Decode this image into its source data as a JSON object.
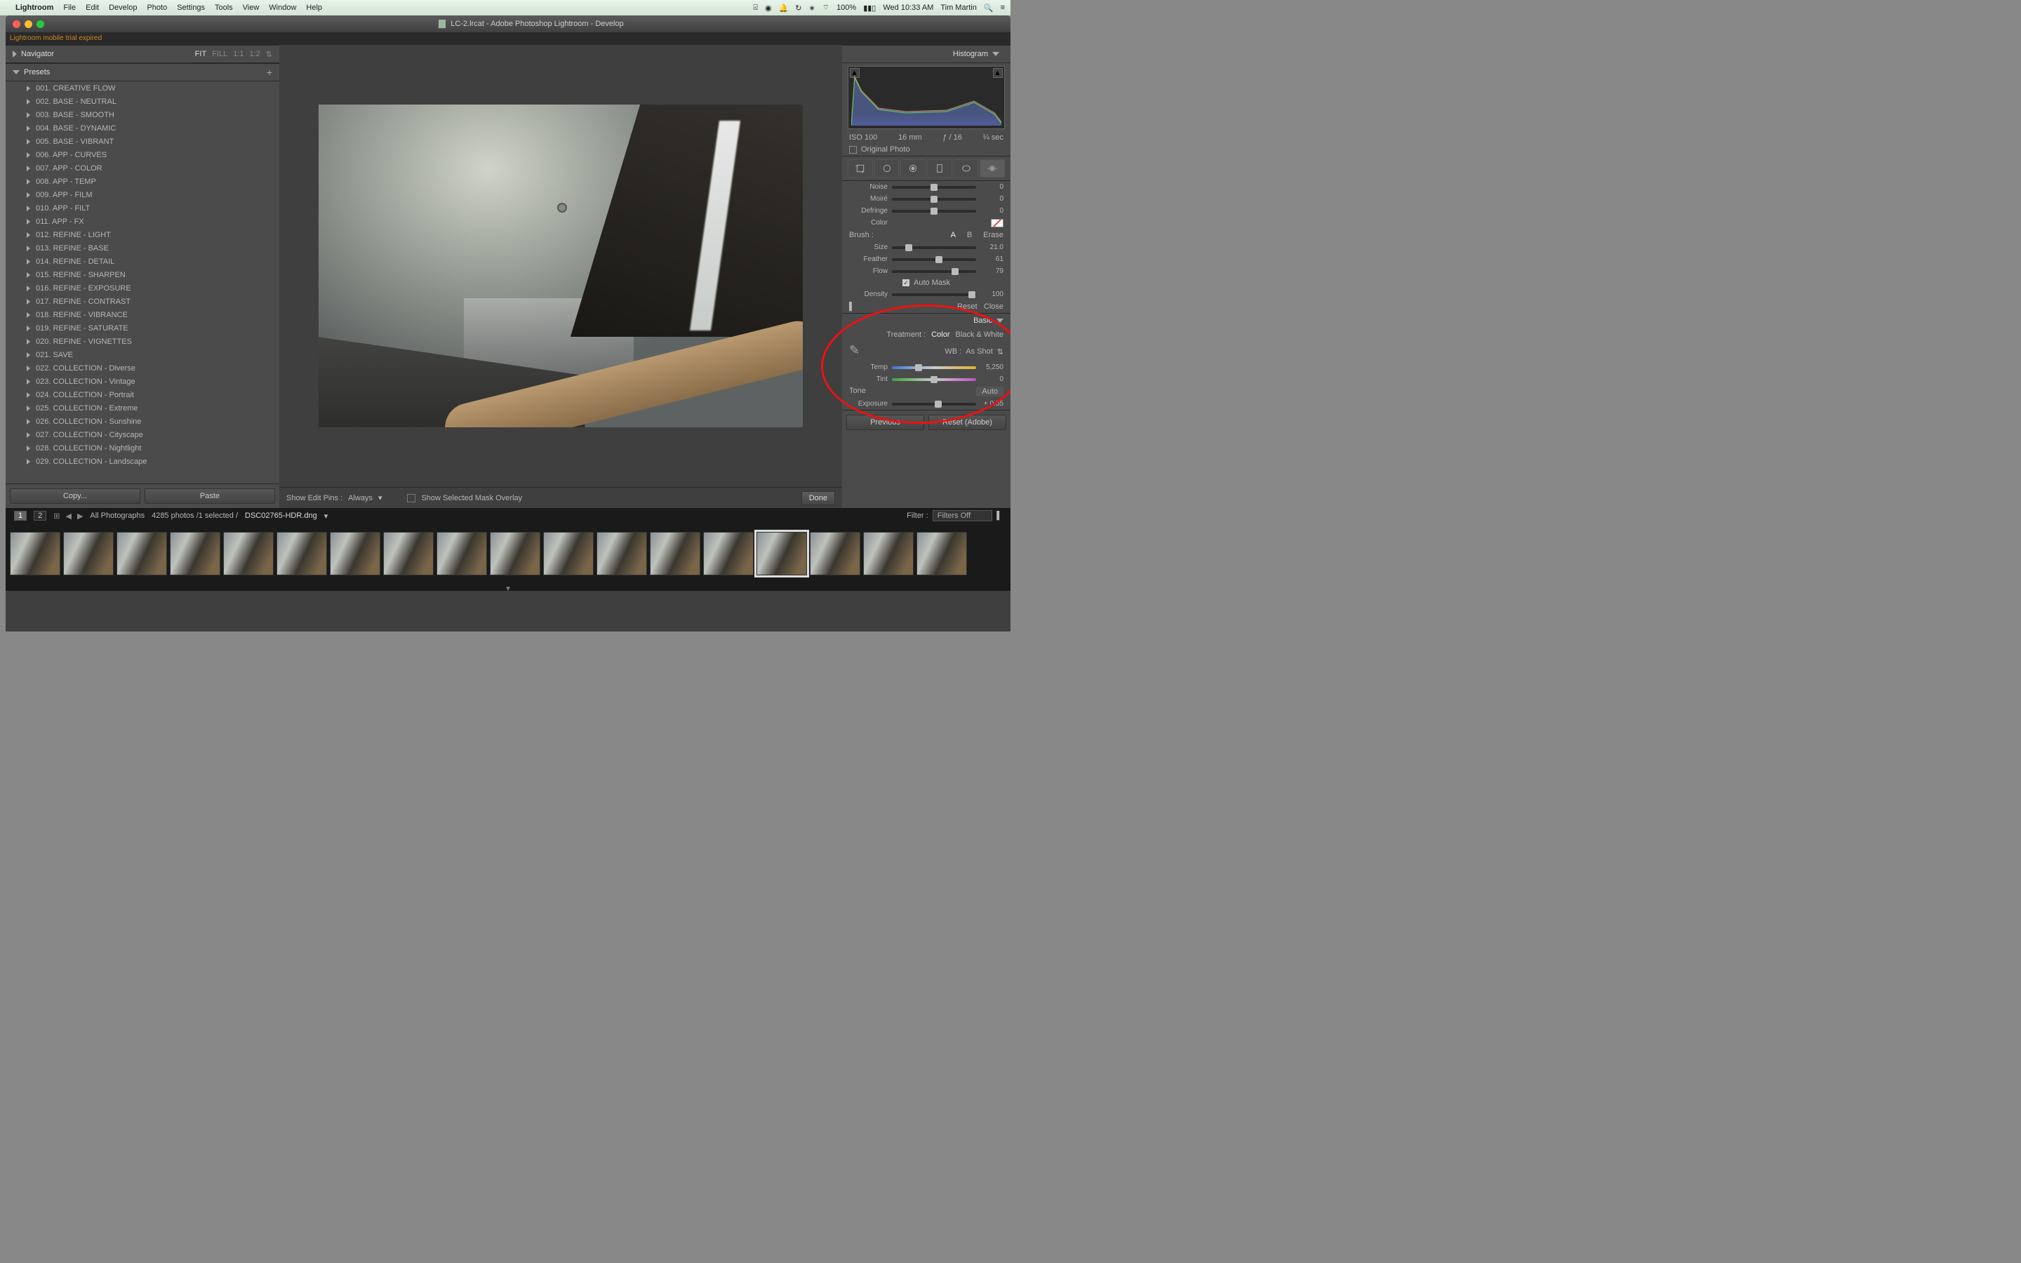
{
  "menubar": {
    "app": "Lightroom",
    "items": [
      "File",
      "Edit",
      "Develop",
      "Photo",
      "Settings",
      "Tools",
      "View",
      "Window",
      "Help"
    ],
    "battery": "100%",
    "time": "Wed 10:33 AM",
    "user": "Tim Martin"
  },
  "titlebar": {
    "title": "LC-2.lrcat - Adobe Photoshop Lightroom - Develop"
  },
  "warn": "Lightroom mobile trial expired",
  "nav": {
    "label": "Navigator",
    "opts": [
      "FIT",
      "FILL",
      "1:1",
      "1:2"
    ]
  },
  "presets": {
    "label": "Presets",
    "items": [
      "001. CREATIVE FLOW",
      "002. BASE - NEUTRAL",
      "003. BASE - SMOOTH",
      "004. BASE - DYNAMIC",
      "005. BASE - VIBRANT",
      "006. APP - CURVES",
      "007. APP - COLOR",
      "008. APP - TEMP",
      "009. APP - FILM",
      "010. APP - FILT",
      "011. APP - FX",
      "012. REFINE - LIGHT",
      "013. REFINE - BASE",
      "014. REFINE - DETAIL",
      "015. REFINE - SHARPEN",
      "016. REFINE - EXPOSURE",
      "017. REFINE - CONTRAST",
      "018. REFINE - VIBRANCE",
      "019. REFINE - SATURATE",
      "020. REFINE - VIGNETTES",
      "021. SAVE",
      "022. COLLECTION - Diverse",
      "023. COLLECTION - Vintage",
      "024. COLLECTION - Portrait",
      "025. COLLECTION - Extreme",
      "026. COLLECTION - Sunshine",
      "027. COLLECTION - Cityscape",
      "028. COLLECTION - Nightlight",
      "029. COLLECTION - Landscape"
    ]
  },
  "leftbtn": {
    "copy": "Copy...",
    "paste": "Paste"
  },
  "centerbar": {
    "pins": "Show Edit Pins :",
    "pinsval": "Always",
    "mask": "Show Selected Mask Overlay",
    "done": "Done"
  },
  "histo": {
    "label": "Histogram",
    "iso": "ISO 100",
    "focal": "16 mm",
    "ap": "ƒ / 16",
    "sh": "¼ sec",
    "orig": "Original Photo"
  },
  "adj": {
    "noise": {
      "label": "Noise",
      "val": "0",
      "pos": 50
    },
    "moire": {
      "label": "Moiré",
      "val": "0",
      "pos": 50
    },
    "defringe": {
      "label": "Defringe",
      "val": "0",
      "pos": 50
    },
    "color": "Color"
  },
  "brush": {
    "label": "Brush :",
    "a": "A",
    "b": "B",
    "erase": "Erase",
    "size": {
      "label": "Size",
      "val": "21.0",
      "pos": 20
    },
    "feather": {
      "label": "Feather",
      "val": "61",
      "pos": 56
    },
    "flow": {
      "label": "Flow",
      "val": "79",
      "pos": 75
    },
    "automask": "Auto Mask",
    "density": {
      "label": "Density",
      "val": "100",
      "pos": 95
    },
    "reset": "Reset",
    "close": "Close"
  },
  "basic": {
    "title": "Basic",
    "treatment": "Treatment :",
    "color": "Color",
    "bw": "Black & White",
    "wblab": "WB :",
    "wb": "As Shot",
    "temp": {
      "label": "Temp",
      "val": "5,250",
      "pos": 32
    },
    "tint": {
      "label": "Tint",
      "val": "0",
      "pos": 50
    },
    "tone": "Tone",
    "auto": "Auto",
    "exposure": {
      "label": "Exposure",
      "val": "+ 0.55",
      "pos": 55
    }
  },
  "rbtns": {
    "prev": "Previous",
    "reset": "Reset (Adobe)"
  },
  "infobar": {
    "p1": "1",
    "p2": "2",
    "title": "All Photographs",
    "count": "4285 photos /1 selected /",
    "file": "DSC02765-HDR.dng",
    "filter": "Filter :",
    "filtersel": "Filters Off"
  },
  "filmstrip": {
    "count": 18,
    "selected": 14
  }
}
